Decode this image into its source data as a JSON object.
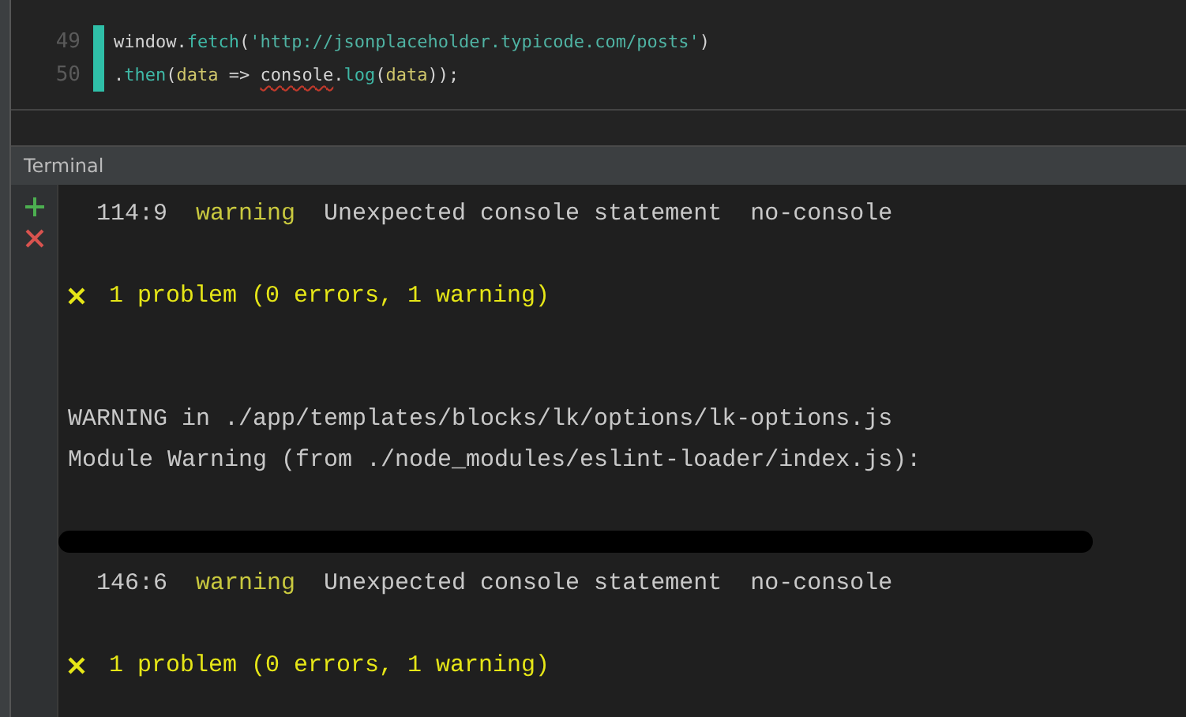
{
  "editor": {
    "lines": [
      {
        "number": "49",
        "changed": true,
        "tokens": [
          {
            "text": "window.",
            "kind": "plain"
          },
          {
            "text": "fetch",
            "kind": "method"
          },
          {
            "text": "(",
            "kind": "plain"
          },
          {
            "text": "'http://jsonplaceholder.typicode.com/posts'",
            "kind": "string"
          },
          {
            "text": ")",
            "kind": "plain"
          }
        ]
      },
      {
        "number": "50",
        "changed": true,
        "tokens": [
          {
            "text": ".",
            "kind": "plain"
          },
          {
            "text": "then",
            "kind": "method"
          },
          {
            "text": "(",
            "kind": "plain"
          },
          {
            "text": "data",
            "kind": "param"
          },
          {
            "text": " => ",
            "kind": "plain"
          },
          {
            "text": "console",
            "kind": "plain",
            "error": true
          },
          {
            "text": ".",
            "kind": "plain"
          },
          {
            "text": "log",
            "kind": "method"
          },
          {
            "text": "(",
            "kind": "plain"
          },
          {
            "text": "data",
            "kind": "param"
          },
          {
            "text": "));",
            "kind": "plain"
          }
        ]
      }
    ]
  },
  "terminal": {
    "title": "Terminal",
    "lines": [
      {
        "kind": "lint",
        "position": "114:9",
        "level": "warning",
        "message": "Unexpected console statement",
        "rule": "no-console"
      },
      {
        "kind": "blank"
      },
      {
        "kind": "summary",
        "text": "1 problem (0 errors, 1 warning)"
      },
      {
        "kind": "blank"
      },
      {
        "kind": "blank"
      },
      {
        "kind": "plain",
        "text": "WARNING in ./app/templates/blocks/lk/options/lk-options.js"
      },
      {
        "kind": "plain",
        "text": "Module Warning (from ./node_modules/eslint-loader/index.js):"
      },
      {
        "kind": "blank"
      },
      {
        "kind": "redacted"
      },
      {
        "kind": "lint",
        "position": "146:6",
        "level": "warning",
        "message": "Unexpected console statement",
        "rule": "no-console"
      },
      {
        "kind": "blank"
      },
      {
        "kind": "summary",
        "text": "1 problem (0 errors, 1 warning)"
      }
    ]
  }
}
